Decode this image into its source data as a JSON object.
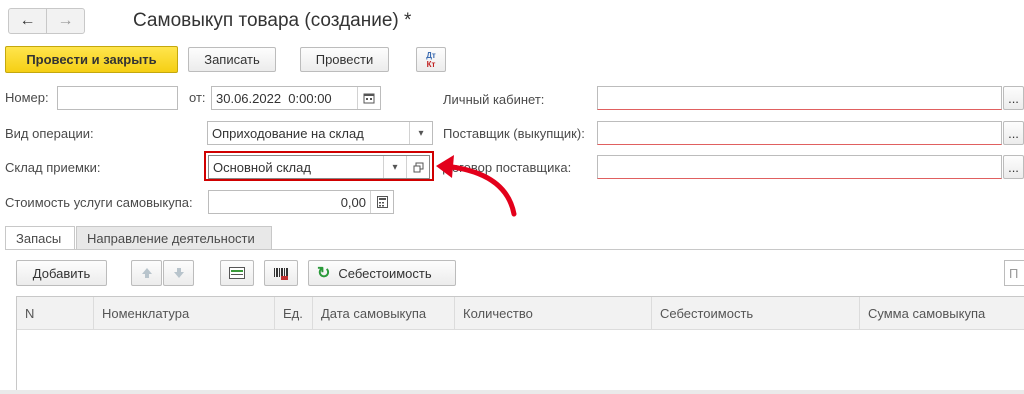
{
  "window": {
    "title": "Самовыкуп товара (создание) *",
    "back_icon": "←",
    "forward_icon": "→"
  },
  "toolbar": {
    "post_close": "Провести и закрыть",
    "save": "Записать",
    "post": "Провести",
    "dt": "Дт",
    "kt": "Кт"
  },
  "form": {
    "number_label": "Номер:",
    "number_value": "",
    "date_label": "от:",
    "date_value": "30.06.2022  0:00:00",
    "operation_label": "Вид операции:",
    "operation_value": "Оприходование на склад",
    "warehouse_label": "Склад приемки:",
    "warehouse_value": "Основной склад",
    "service_cost_label": "Стоимость услуги самовыкупа:",
    "service_cost_value": "0,00",
    "cabinet_label": "Личный кабинет:",
    "cabinet_value": "",
    "supplier_label": "Поставщик (выкупщик):",
    "supplier_value": "",
    "contract_label": "Договор поставщика:",
    "contract_value": ""
  },
  "tabs": [
    "Запасы",
    "Направление деятельности"
  ],
  "table_toolbar": {
    "add": "Добавить",
    "cost": "Себестоимость",
    "search_placeholder": "П"
  },
  "table": {
    "columns": [
      "N",
      "Номенклатура",
      "Ед.",
      "Дата самовыкупа",
      "Количество",
      "Себестоимость",
      "Сумма самовыкупа"
    ]
  },
  "colors": {
    "primary_button": "#f5cf14",
    "highlight_border": "#d00000",
    "arrow": "#e3001b",
    "required_underline": "#e06060"
  }
}
